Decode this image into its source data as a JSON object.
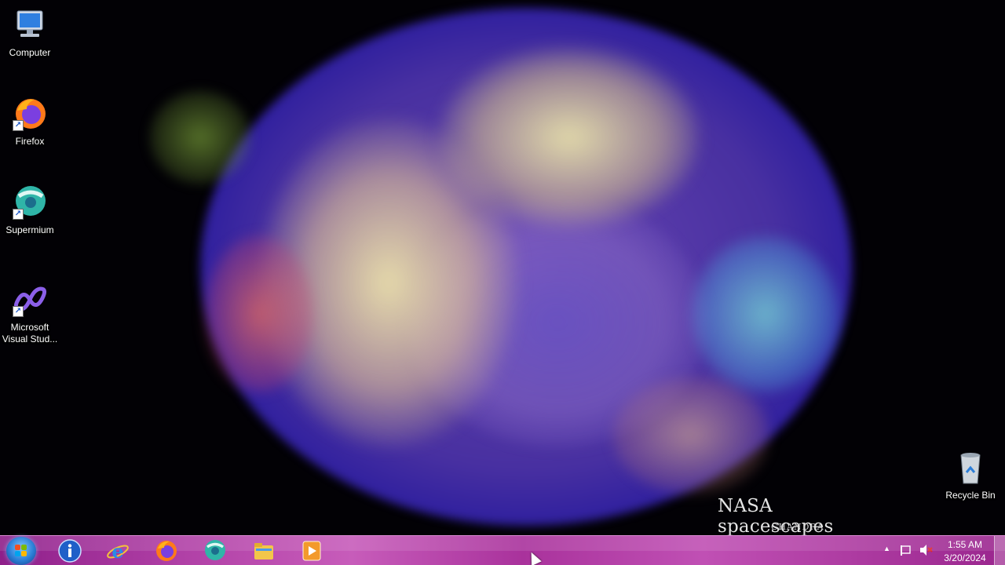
{
  "desktop": {
    "icons": [
      {
        "label": "Computer",
        "icon": "computer-icon"
      },
      {
        "label": "Firefox",
        "icon": "firefox-icon"
      },
      {
        "label": "Supermium",
        "icon": "supermium-icon"
      },
      {
        "label_line1": "Microsoft",
        "label_line2": "Visual Stud...",
        "icon": "visual-studio-icon"
      },
      {
        "label": "Recycle Bin",
        "icon": "recycle-bin-icon"
      }
    ],
    "wallpaper": {
      "title": "NASA spacescapes",
      "subtitle": "CHANDRA"
    }
  },
  "taskbar": {
    "start": {
      "icon": "windows-start-icon"
    },
    "pinned": [
      {
        "icon": "info-icon"
      },
      {
        "icon": "internet-explorer-icon"
      },
      {
        "icon": "firefox-icon"
      },
      {
        "icon": "supermium-icon"
      },
      {
        "icon": "file-explorer-icon"
      },
      {
        "icon": "media-player-icon"
      }
    ],
    "tray": {
      "show_hidden": "▲",
      "icons": [
        "action-center-flag-icon",
        "volume-muted-icon"
      ],
      "time": "1:55 AM",
      "date": "3/20/2024"
    }
  },
  "colors": {
    "taskbar_accent": "#b040a6",
    "start_orb": "#2b7ed6"
  }
}
